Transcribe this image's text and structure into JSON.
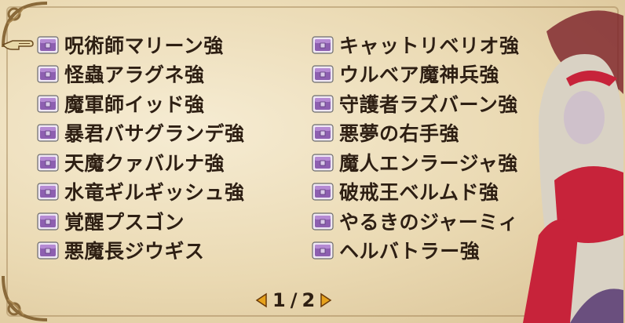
{
  "list": {
    "left": [
      {
        "label": "呪術師マリーン強"
      },
      {
        "label": "怪蟲アラグネ強"
      },
      {
        "label": "魔軍師イッド強"
      },
      {
        "label": "暴君バサグランデ強"
      },
      {
        "label": "天魔クァバルナ強"
      },
      {
        "label": "水竜ギルギッシュ強"
      },
      {
        "label": "覚醒プスゴン"
      },
      {
        "label": "悪魔長ジウギス"
      }
    ],
    "right": [
      {
        "label": "キャットリベリオ強"
      },
      {
        "label": "ウルベア魔神兵強"
      },
      {
        "label": "守護者ラズバーン強"
      },
      {
        "label": "悪夢の右手強"
      },
      {
        "label": "魔人エンラージャ強"
      },
      {
        "label": "破戒王ベルムド強"
      },
      {
        "label": "やるきのジャーミィ"
      },
      {
        "label": "ヘルバトラー強"
      }
    ]
  },
  "pager": {
    "current": "1",
    "separator": "/",
    "total": "2"
  },
  "colors": {
    "chest_purple": "#8d5fb0",
    "text": "#2e1f12",
    "parchment": "#efe3c4"
  },
  "icons": {
    "cursor": "pointing-hand-icon",
    "item": "purple-chest-icon",
    "prev": "arrow-left-icon",
    "next": "arrow-right-icon"
  }
}
